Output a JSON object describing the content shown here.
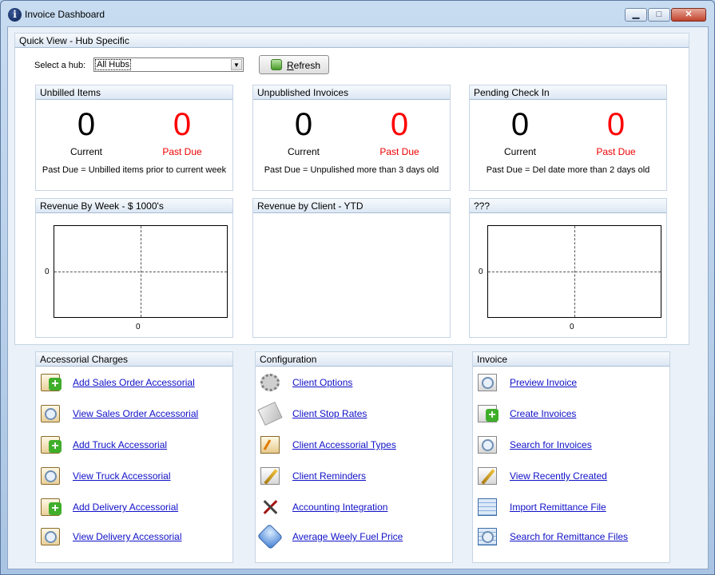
{
  "window": {
    "title": "Invoice Dashboard",
    "buttons": {
      "minimize": "▁",
      "maximize": "□",
      "close": "✕"
    }
  },
  "quick_view": {
    "header": "Quick View - Hub Specific",
    "hub_label": "Select a hub:",
    "hub_value": "All Hubs",
    "refresh_label": "Refresh"
  },
  "stats": [
    {
      "title": "Unbilled Items",
      "current": "0",
      "past_due": "0",
      "current_label": "Current",
      "past_due_label": "Past Due",
      "note": "Past Due = Unbilled items prior to current week"
    },
    {
      "title": "Unpublished Invoices",
      "current": "0",
      "past_due": "0",
      "current_label": "Current",
      "past_due_label": "Past Due",
      "note": "Past Due = Unpulished more than 3 days old"
    },
    {
      "title": "Pending Check In",
      "current": "0",
      "past_due": "0",
      "current_label": "Current",
      "past_due_label": "Past Due",
      "note": "Past Due = Del date more than 2 days old"
    }
  ],
  "charts": [
    {
      "title": "Revenue By Week - $ 1000's",
      "y_tick": "0",
      "x_tick": "0"
    },
    {
      "title": "Revenue by Client - YTD"
    },
    {
      "title": "???",
      "y_tick": "0",
      "x_tick": "0"
    }
  ],
  "panels": {
    "accessorial": {
      "header": "Accessorial Charges",
      "links": [
        "Add Sales Order Accessorial",
        "View Sales Order Accessorial",
        "Add Truck Accessorial",
        "View Truck Accessorial",
        "Add Delivery Accessorial",
        "View Delivery Accessorial"
      ]
    },
    "configuration": {
      "header": "Configuration",
      "links": [
        "Client Options",
        "Client Stop Rates",
        "Client Accessorial Types",
        "Client Reminders",
        "Accounting Integration",
        "Average Weely Fuel Price"
      ]
    },
    "invoice": {
      "header": "Invoice",
      "links": [
        "Preview Invoice",
        "Create Invoices",
        "Search for Invoices",
        "View Recently Created",
        "Import Remittance File",
        "Search for Remittance Files"
      ]
    }
  }
}
